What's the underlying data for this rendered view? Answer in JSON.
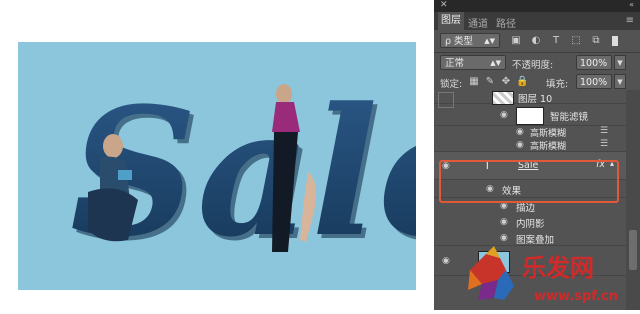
{
  "document": {
    "headline": "Sale",
    "bg_color": "#8cc6dc",
    "letter_color": "#1e4a7a"
  },
  "panel": {
    "tabs": [
      "图层",
      "通道",
      "路径"
    ],
    "filter_label": "ρ 类型",
    "blend_mode": "正常",
    "opacity_label": "不透明度:",
    "opacity_value": "100%",
    "lock_label": "锁定:",
    "fill_label": "填充:",
    "fill_value": "100%",
    "layers": [
      {
        "name": "图层 10",
        "kind": "pixel"
      },
      {
        "name": "智能滤镜",
        "kind": "smart-filter"
      },
      {
        "name": "高斯模糊",
        "kind": "filter"
      },
      {
        "name": "高斯模糊",
        "kind": "filter"
      },
      {
        "name": "Sale",
        "kind": "text",
        "badge": "fx"
      },
      {
        "name": "效果",
        "kind": "effects"
      },
      {
        "name": "描边",
        "kind": "effect"
      },
      {
        "name": "内阴影",
        "kind": "effect"
      },
      {
        "name": "图案叠加",
        "kind": "effect"
      }
    ],
    "highlight_color": "#e05a3a"
  },
  "watermark": {
    "brand": "乐发网",
    "url": "www.spf.cn"
  }
}
